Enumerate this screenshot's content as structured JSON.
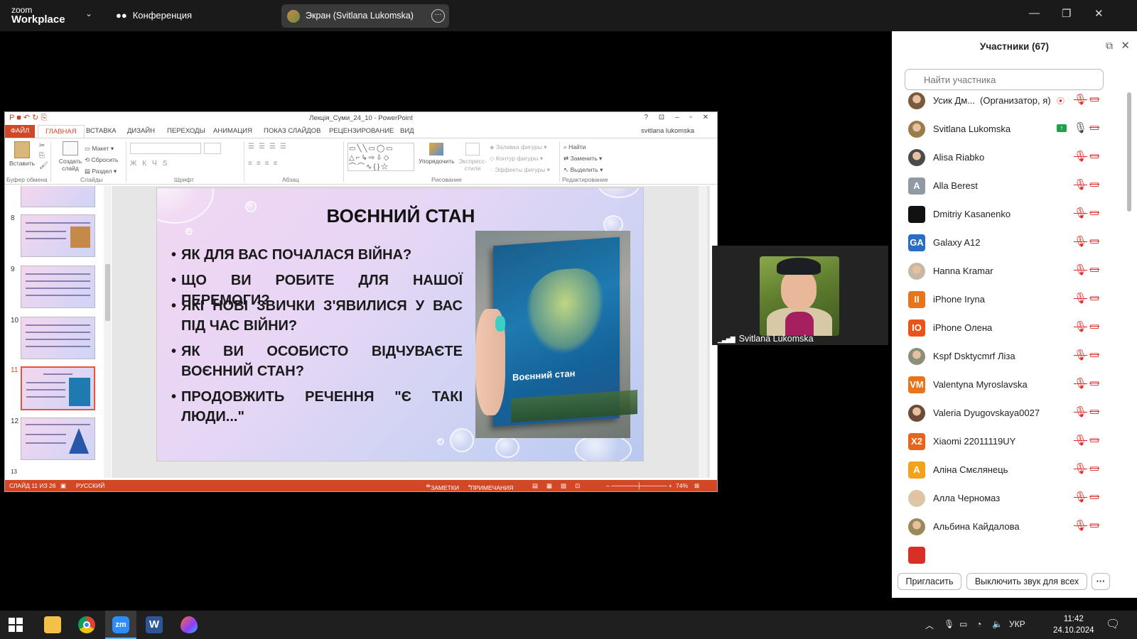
{
  "topbar": {
    "brand_top": "zoom",
    "brand_bottom": "Workplace",
    "meeting_label": "Конференция",
    "share_label": "Экран (Svitlana Lukomska)"
  },
  "ppt": {
    "title": "Лекція_Суми_24_10 - PowerPoint",
    "tabs": [
      "ФАЙЛ",
      "ГЛАВНАЯ",
      "ВСТАВКА",
      "ДИЗАЙН",
      "ПЕРЕХОДЫ",
      "АНИМАЦИЯ",
      "ПОКАЗ СЛАЙДОВ",
      "РЕЦЕНЗИРОВАНИЕ",
      "ВИД"
    ],
    "user": "svitlana lukomska",
    "ribbon": {
      "paste": "Вставить",
      "layout": "Макет",
      "reset": "Сбросить",
      "section": "Раздел",
      "create_slide": "Создать слайд",
      "arrange": "Упорядочить",
      "express": "Экспресс-стили",
      "fill": "Заливка фигуры",
      "outline": "Контур фигуры",
      "effects": "Эффекты фигуры",
      "find": "Найти",
      "replace": "Заменить",
      "select": "Выделить"
    },
    "groups": [
      "Буфер обмена",
      "Слайды",
      "Шрифт",
      "Абзац",
      "Рисование",
      "Редактирование"
    ],
    "thumb_numbers": [
      "8",
      "9",
      "10",
      "11",
      "12",
      "13"
    ],
    "slide": {
      "title": "ВОЄННИЙ СТАН",
      "bullets": [
        "ЯК ДЛЯ ВАС ПОЧАЛАСЯ ВІЙНА?",
        "ЩО ВИ РОБИТЕ ДЛЯ НАШОЇ ПЕРЕМОГИ?",
        "ЯКІ НОВІ ЗВИЧКИ З'ЯВИЛИСЯ У ВАС ПІД ЧАС ВІЙНИ?",
        "ЯК ВИ ОСОБИСТО ВІДЧУВАЄТЕ ВОЄННИЙ СТАН?",
        "ПРОДОВЖИТЬ РЕЧЕННЯ \"Є ТАКІ ЛЮДИ...\""
      ],
      "book_title": "Воєнний стан"
    },
    "status": {
      "slide_info": "СЛАЙД 11 ИЗ 26",
      "language": "РУССКИЙ",
      "notes": "ЗАМЕТКИ",
      "comments": "ПРИМЕЧАНИЯ",
      "zoom": "74%"
    }
  },
  "video": {
    "name": "Svitlana Lukomska"
  },
  "participants": {
    "title": "Участники (67)",
    "search_placeholder": "Найти участника",
    "invite_label": "Пригласить",
    "mute_all_label": "Выключить звук для всех",
    "list": [
      {
        "name": "Усик Дм...",
        "role": "(Организатор, я)",
        "avatar": "photo",
        "color": "#7a5a3c"
      },
      {
        "name": "Svitlana Lukomska",
        "avatar": "photo",
        "color": "#9a7b4a"
      },
      {
        "name": "Alisa Riabko",
        "avatar": "photo",
        "color": "#4a4a4a"
      },
      {
        "name": "Alla Berest",
        "avatar": "A",
        "color": "#8f9aa3"
      },
      {
        "name": "Dmitriy Kasanenko",
        "avatar": "",
        "color": "#111111"
      },
      {
        "name": "Galaxy A12",
        "avatar": "GA",
        "color": "#2b6cc4"
      },
      {
        "name": "Hanna Kramar",
        "avatar": "photo",
        "color": "#c7b8a6"
      },
      {
        "name": "iPhone Iryna",
        "avatar": "II",
        "color": "#e8741b"
      },
      {
        "name": "iPhone Олена",
        "avatar": "IO",
        "color": "#e8541b"
      },
      {
        "name": "Kspf Dsktycmrf Ліза",
        "avatar": "photo",
        "color": "#8a8f77"
      },
      {
        "name": "Valentyna Myroslavska",
        "avatar": "VM",
        "color": "#e8741b"
      },
      {
        "name": "Valeria Dyugovskaya0027",
        "avatar": "photo",
        "color": "#6b4a3a"
      },
      {
        "name": "Xiaomi 22011119UY",
        "avatar": "X2",
        "color": "#e8641b"
      },
      {
        "name": "Аліна Смєлянець",
        "avatar": "A",
        "color": "#f2a31b"
      },
      {
        "name": "Алла Черномаз",
        "avatar": "photo",
        "color": "#d9c7a8"
      },
      {
        "name": "Альбина Кайдалова",
        "avatar": "photo",
        "color": "#9a8a5a"
      }
    ]
  },
  "taskbar": {
    "lang": "УКР",
    "time": "11:42",
    "date": "24.10.2024"
  }
}
